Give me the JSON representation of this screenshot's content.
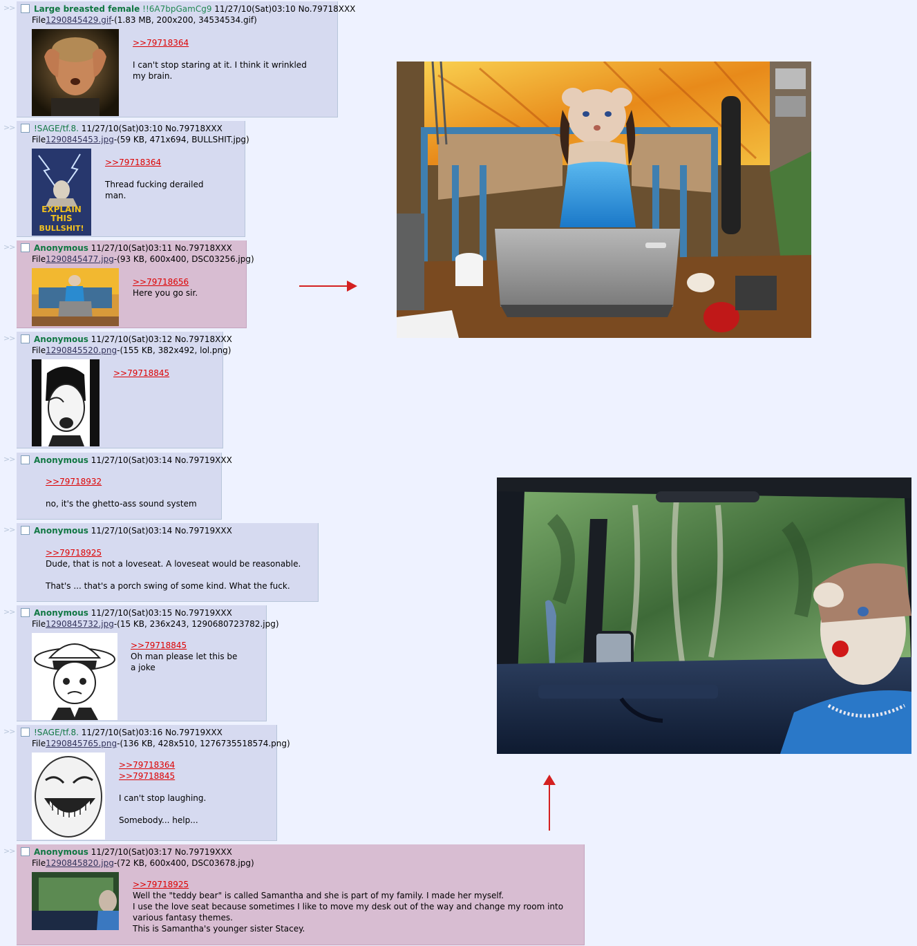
{
  "posts": [
    {
      "name": "Large breasted female",
      "tripcode": "!!6A7bpGamCg9",
      "datetime": "11/27/10(Sat)03:10",
      "number": "No.79718XXX",
      "file_label": "File",
      "file_link": "1290845429.gif",
      "file_info": "-(1.83 MB, 200x200, 34534534.gif)",
      "quote": ">>79718364",
      "lines": [
        "I can't stop staring at it. I think it wrinkled",
        "my brain."
      ]
    },
    {
      "name": "!SAGE/tf.8.",
      "datetime": "11/27/10(Sat)03:10",
      "number": "No.79718XXX",
      "file_label": "File",
      "file_link": "1290845453.jpg",
      "file_info": "-(59 KB, 471x694, BULLSHIT.jpg)",
      "quote": ">>79718364",
      "lines": [
        "Thread fucking derailed",
        "man."
      ],
      "thumb_text": "EXPLAIN THIS BULLSHIT!"
    },
    {
      "name": "Anonymous",
      "datetime": "11/27/10(Sat)03:11",
      "number": "No.79718XXX",
      "file_label": "File",
      "file_link": "1290845477.jpg",
      "file_info": "-(93 KB, 600x400, DSC03256.jpg)",
      "quote": ">>79718656",
      "lines": [
        "Here you go sir."
      ]
    },
    {
      "name": "Anonymous",
      "datetime": "11/27/10(Sat)03:12",
      "number": "No.79718XXX",
      "file_label": "File",
      "file_link": "1290845520.png",
      "file_info": "-(155 KB, 382x492, lol.png)",
      "quote": ">>79718845",
      "lines": []
    },
    {
      "name": "Anonymous",
      "datetime": "11/27/10(Sat)03:14",
      "number": "No.79719XXX",
      "quote": ">>79718932",
      "lines": [
        "no, it's the ghetto-ass sound system"
      ]
    },
    {
      "name": "Anonymous",
      "datetime": "11/27/10(Sat)03:14",
      "number": "No.79719XXX",
      "quote": ">>79718925",
      "lines": [
        "Dude, that is not a loveseat. A loveseat would be reasonable.",
        "That's ... that's a porch swing of some kind. What the fuck."
      ]
    },
    {
      "name": "Anonymous",
      "datetime": "11/27/10(Sat)03:15",
      "number": "No.79719XXX",
      "file_label": "File",
      "file_link": "1290845732.jpg",
      "file_info": "-(15 KB, 236x243, 1290680723782.jpg)",
      "quote": ">>79718845",
      "lines": [
        "Oh man please let this be",
        "a joke"
      ]
    },
    {
      "name": "!SAGE/tf.8.",
      "datetime": "11/27/10(Sat)03:16",
      "number": "No.79719XXX",
      "file_label": "File",
      "file_link": "1290845765.png",
      "file_info": "-(136 KB, 428x510, 1276735518574.png)",
      "quote": ">>79718364",
      "quote2": ">>79718845",
      "lines": [
        "I can't stop laughing.",
        "Somebody... help..."
      ]
    },
    {
      "name": "Anonymous",
      "datetime": "11/27/10(Sat)03:17",
      "number": "No.79719XXX",
      "file_label": "File",
      "file_link": "1290845820.jpg",
      "file_info": "-(72 KB, 600x400, DSC03678.jpg)",
      "quote": ">>79718925",
      "lines": [
        "Well the \"teddy bear\" is called Samantha and she is part of my family. I made her myself.",
        "I use the love seat because sometimes I like to move my desk out of the way and change my room into",
        "various fantasy themes.",
        "This is Samantha's younger sister Stacey."
      ]
    }
  ],
  "arrows_glyph": ">>",
  "colors": {
    "page_bg": "#eef2ff",
    "reply_bg": "#d6daf0",
    "highlight_bg": "#d8bdd2",
    "name": "#117743",
    "quote_link": "#dd0000",
    "annotation_arrow": "#d42020"
  }
}
